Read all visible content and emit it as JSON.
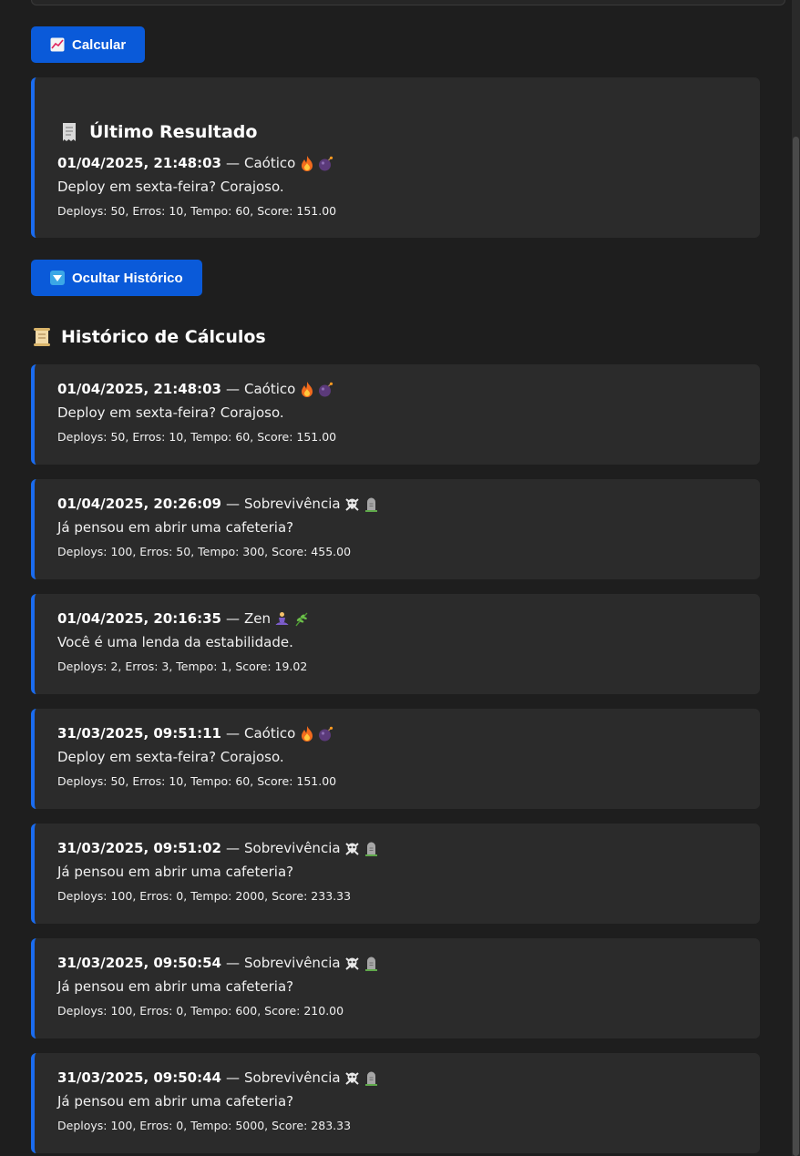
{
  "buttons": {
    "calculate": "Calcular",
    "toggle_history": "Ocultar Histórico"
  },
  "last_result": {
    "title": "Último Resultado",
    "timestamp": "01/04/2025, 21:48:03",
    "separator": "—",
    "category": "Caótico",
    "icons": [
      "fire-icon",
      "bomb-icon"
    ],
    "message": "Deploy em sexta-feira? Corajoso.",
    "details": "Deploys: 50, Erros: 10, Tempo: 60, Score: 151.00"
  },
  "history": {
    "title": "Histórico de Cálculos",
    "items": [
      {
        "timestamp": "01/04/2025, 21:48:03",
        "separator": "—",
        "category": "Caótico",
        "icons": [
          "fire-icon",
          "bomb-icon"
        ],
        "message": "Deploy em sexta-feira? Corajoso.",
        "details": "Deploys: 50, Erros: 10, Tempo: 60, Score: 151.00"
      },
      {
        "timestamp": "01/04/2025, 20:26:09",
        "separator": "—",
        "category": "Sobrevivência",
        "icons": [
          "skull-crossbones-icon",
          "headstone-icon"
        ],
        "message": "Já pensou em abrir uma cafeteria?",
        "details": "Deploys: 100, Erros: 50, Tempo: 300, Score: 455.00"
      },
      {
        "timestamp": "01/04/2025, 20:16:35",
        "separator": "—",
        "category": "Zen",
        "icons": [
          "meditation-icon",
          "herb-icon"
        ],
        "message": "Você é uma lenda da estabilidade.",
        "details": "Deploys: 2, Erros: 3, Tempo: 1, Score: 19.02"
      },
      {
        "timestamp": "31/03/2025, 09:51:11",
        "separator": "—",
        "category": "Caótico",
        "icons": [
          "fire-icon",
          "bomb-icon"
        ],
        "message": "Deploy em sexta-feira? Corajoso.",
        "details": "Deploys: 50, Erros: 10, Tempo: 60, Score: 151.00"
      },
      {
        "timestamp": "31/03/2025, 09:51:02",
        "separator": "—",
        "category": "Sobrevivência",
        "icons": [
          "skull-crossbones-icon",
          "headstone-icon"
        ],
        "message": "Já pensou em abrir uma cafeteria?",
        "details": "Deploys: 100, Erros: 0, Tempo: 2000, Score: 233.33"
      },
      {
        "timestamp": "31/03/2025, 09:50:54",
        "separator": "—",
        "category": "Sobrevivência",
        "icons": [
          "skull-crossbones-icon",
          "headstone-icon"
        ],
        "message": "Já pensou em abrir uma cafeteria?",
        "details": "Deploys: 100, Erros: 0, Tempo: 600, Score: 210.00"
      },
      {
        "timestamp": "31/03/2025, 09:50:44",
        "separator": "—",
        "category": "Sobrevivência",
        "icons": [
          "skull-crossbones-icon",
          "headstone-icon"
        ],
        "message": "Já pensou em abrir uma cafeteria?",
        "details": "Deploys: 100, Erros: 0, Tempo: 5000, Score: 283.33"
      }
    ]
  },
  "colors": {
    "background": "#1e1e1e",
    "card": "#2b2b2b",
    "accent": "#1a6cf0",
    "button": "#0a5ad9"
  }
}
